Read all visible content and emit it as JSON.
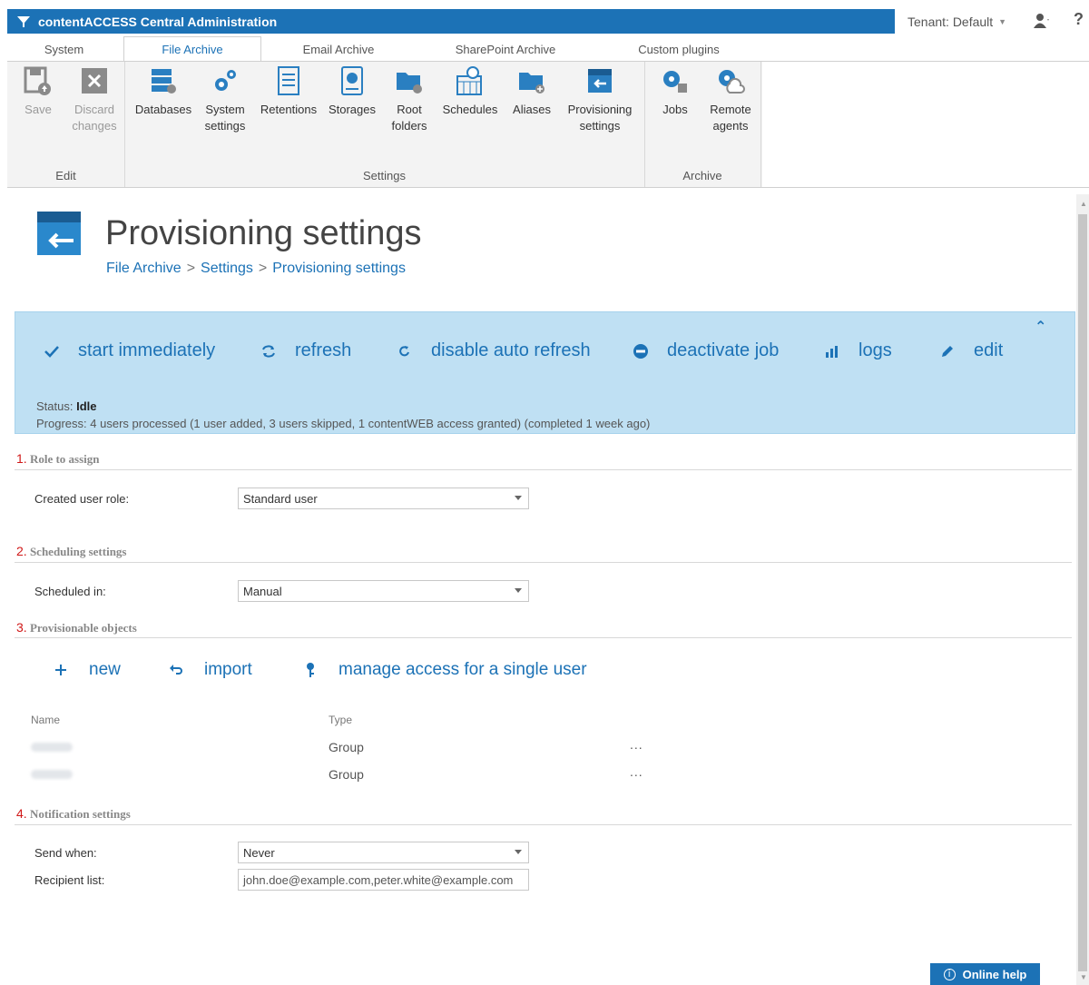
{
  "app": {
    "title": "contentACCESS Central Administration"
  },
  "tenant": {
    "label": "Tenant: Default"
  },
  "help_glyph": "?",
  "tabs": [
    {
      "label": "System"
    },
    {
      "label": "File Archive",
      "active": true
    },
    {
      "label": "Email Archive"
    },
    {
      "label": "SharePoint Archive"
    },
    {
      "label": "Custom plugins"
    }
  ],
  "ribbon": {
    "edit": {
      "label": "Edit",
      "save": "Save",
      "discard_1": "Discard",
      "discard_2": "changes"
    },
    "settings": {
      "label": "Settings",
      "databases": "Databases",
      "system_1": "System",
      "system_2": "settings",
      "retentions": "Retentions",
      "storages": "Storages",
      "root_1": "Root",
      "root_2": "folders",
      "schedules": "Schedules",
      "aliases": "Aliases",
      "prov_1": "Provisioning",
      "prov_2": "settings"
    },
    "archive": {
      "label": "Archive",
      "jobs": "Jobs",
      "remote_1": "Remote",
      "remote_2": "agents"
    }
  },
  "page": {
    "title": "Provisioning settings",
    "breadcrumb": [
      "File Archive",
      "Settings",
      "Provisioning settings"
    ]
  },
  "actions": {
    "start": "start immediately",
    "refresh": "refresh",
    "auto_refresh": "disable auto refresh",
    "deactivate": "deactivate job",
    "logs": "logs",
    "edit": "edit"
  },
  "status": {
    "label": "Status:",
    "value": "Idle",
    "progress_label": "Progress:",
    "progress_value": "4 users processed (1 user added, 3 users skipped, 1 contentWEB access granted) (completed 1 week ago)"
  },
  "sections": {
    "role": {
      "num": "1.",
      "title": "Role to assign",
      "field": "Created user role:",
      "value": "Standard user"
    },
    "schedule": {
      "num": "2.",
      "title": "Scheduling settings",
      "field": "Scheduled in:",
      "value": "Manual"
    },
    "objects": {
      "num": "3.",
      "title": "Provisionable objects",
      "new": "new",
      "import": "import",
      "manage": "manage access for a single user",
      "col_name": "Name",
      "col_type": "Type",
      "rows": [
        {
          "type": "Group",
          "more": "..."
        },
        {
          "type": "Group",
          "more": "..."
        }
      ]
    },
    "notify": {
      "num": "4.",
      "title": "Notification settings",
      "send_field": "Send when:",
      "send_value": "Never",
      "recipients_field": "Recipient list:",
      "recipients_value": "john.doe@example.com,peter.white@example.com"
    }
  },
  "online_help": "Online help",
  "colors": {
    "accent": "#1c72b6",
    "panel": "#bfe0f3",
    "section_number": "#d01818"
  }
}
